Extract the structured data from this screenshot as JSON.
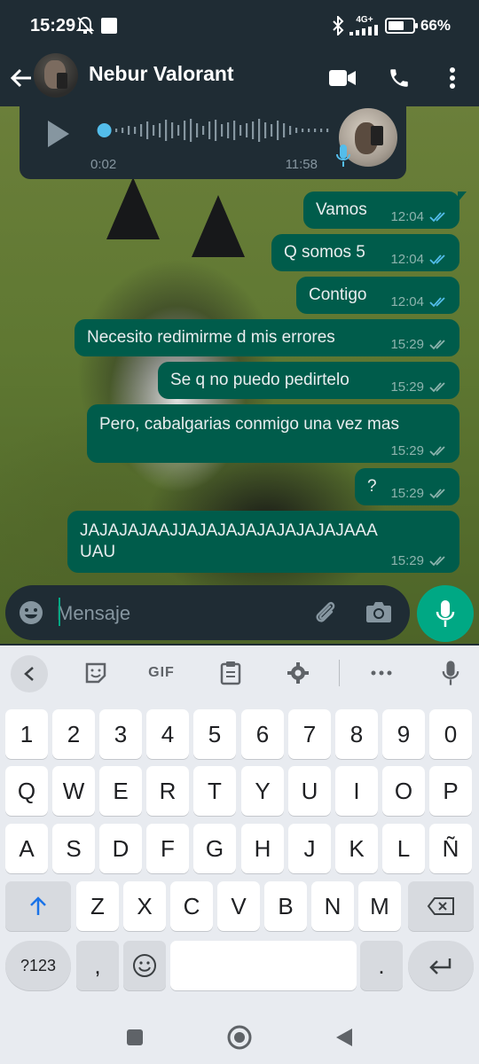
{
  "status_bar": {
    "time": "15:29",
    "network": "4G+",
    "battery_text": "66%",
    "battery_level": 0.66,
    "icons": [
      "notifications-off-icon",
      "square-notification-icon",
      "bluetooth-icon",
      "signal-icon",
      "battery-icon"
    ]
  },
  "header": {
    "contact_name": "Nebur Valorant",
    "icons": [
      "back-arrow-icon",
      "video-call-icon",
      "phone-icon",
      "more-vert-icon"
    ]
  },
  "voice_message": {
    "elapsed": "0:02",
    "sent_time": "11:58",
    "playback_progress": 0.04
  },
  "messages": [
    {
      "text": "Vamos",
      "time": "12:04",
      "status": "read"
    },
    {
      "text": "Q somos 5",
      "time": "12:04",
      "status": "read"
    },
    {
      "text": "Contigo",
      "time": "12:04",
      "status": "read"
    },
    {
      "text": "Necesito redimirme d mis errores",
      "time": "15:29",
      "status": "delivered"
    },
    {
      "text": "Se q no puedo pedirtelo",
      "time": "15:29",
      "status": "delivered"
    },
    {
      "text": "Pero, cabalgarias conmigo una vez mas",
      "time": "15:29",
      "status": "delivered"
    },
    {
      "text": "?",
      "time": "15:29",
      "status": "delivered"
    },
    {
      "text_line1": "JAJAJAJAAJJAJAJAJAJAJAJAJAJAAA",
      "text_line2": "UAU",
      "time": "15:29",
      "status": "delivered"
    }
  ],
  "input": {
    "placeholder": "Mensaje",
    "value": ""
  },
  "keyboard": {
    "toolbar": {
      "gif_label": "GIF"
    },
    "row_numbers": [
      "1",
      "2",
      "3",
      "4",
      "5",
      "6",
      "7",
      "8",
      "9",
      "0"
    ],
    "row1": [
      "Q",
      "W",
      "E",
      "R",
      "T",
      "Y",
      "U",
      "I",
      "O",
      "P"
    ],
    "row2": [
      "A",
      "S",
      "D",
      "F",
      "G",
      "H",
      "J",
      "K",
      "L",
      "Ñ"
    ],
    "row3": [
      "Z",
      "X",
      "C",
      "V",
      "B",
      "N",
      "M"
    ],
    "bottom": {
      "symbols": "?123",
      "comma": ",",
      "period": "."
    }
  },
  "colors": {
    "header_bg": "#1f2c34",
    "outgoing_bubble": "#005c4b",
    "accent": "#00a884",
    "read_check": "#53bdeb"
  }
}
